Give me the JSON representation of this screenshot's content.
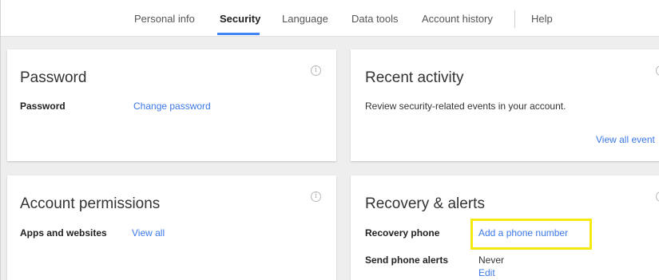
{
  "nav": {
    "tabs": [
      {
        "label": "Personal info"
      },
      {
        "label": "Security"
      },
      {
        "label": "Language"
      },
      {
        "label": "Data tools"
      },
      {
        "label": "Account history"
      },
      {
        "label": "Help"
      }
    ],
    "active_tab": "Security",
    "accent_color": "#4285f4"
  },
  "password_card": {
    "title": "Password",
    "row_label": "Password",
    "action": "Change password",
    "info_icon": "info-circle-icon"
  },
  "recent_activity_card": {
    "title": "Recent activity",
    "description": "Review security-related events in your account.",
    "action": "View all event",
    "info_icon": "info-circle-icon"
  },
  "permissions_card": {
    "title": "Account permissions",
    "row_label": "Apps and websites",
    "action": "View all",
    "info_icon": "info-circle-icon"
  },
  "recovery_card": {
    "title": "Recovery & alerts",
    "recovery_phone_label": "Recovery phone",
    "recovery_phone_action": "Add a phone number",
    "alerts_label": "Send phone alerts",
    "alerts_value": "Never",
    "alerts_action": "Edit",
    "info_icon": "info-circle-icon",
    "highlight_color": "#f5e90f"
  },
  "colors": {
    "link": "#3b78e7",
    "background": "#eeeeee"
  }
}
